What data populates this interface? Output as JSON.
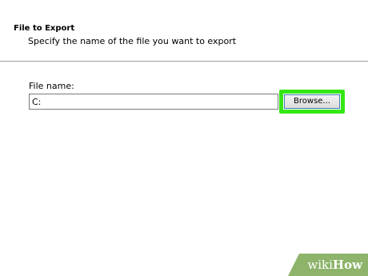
{
  "header": {
    "title": "File to Export",
    "subtitle": "Specify the name of the file you want to export"
  },
  "form": {
    "file_name_label": "File name:",
    "file_name_value": "C:",
    "browse_label": "Browse..."
  },
  "highlight": {
    "color": "#35e617"
  },
  "watermark": {
    "part1": "wiki",
    "part2": "How",
    "color": "#8db46a"
  }
}
